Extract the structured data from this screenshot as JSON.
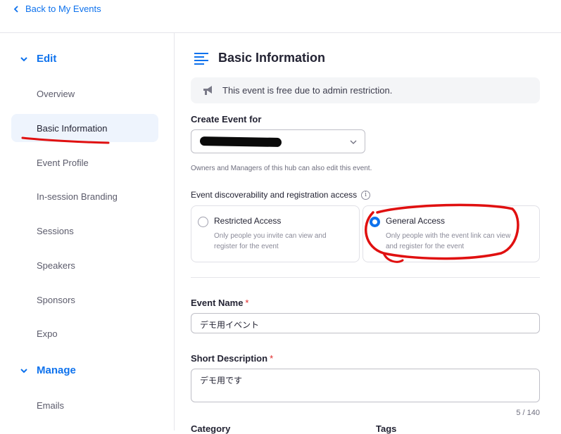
{
  "header": {
    "back_label": "Back to My Events"
  },
  "sidebar": {
    "edit_section": "Edit",
    "manage_section": "Manage",
    "items": [
      {
        "label": "Overview"
      },
      {
        "label": "Basic Information",
        "active": true
      },
      {
        "label": "Event Profile"
      },
      {
        "label": "In-session Branding"
      },
      {
        "label": "Sessions"
      },
      {
        "label": "Speakers"
      },
      {
        "label": "Sponsors"
      },
      {
        "label": "Expo"
      }
    ],
    "manage_items": [
      {
        "label": "Emails"
      }
    ]
  },
  "main": {
    "title": "Basic Information",
    "notice": "This event is free due to admin restriction.",
    "create_for_label": "Create Event for",
    "create_for_helper": "Owners and Managers of this hub can also edit this event.",
    "access_label": "Event discoverability and registration access",
    "access_info_glyph": "i",
    "access_options": [
      {
        "title": "Restricted Access",
        "desc": "Only people you invite can view and register for the event",
        "selected": false
      },
      {
        "title": "General Access",
        "desc": "Only people with the event link can view and register for the event",
        "selected": true
      }
    ],
    "event_name_label": "Event Name",
    "event_name_value": "デモ用イベント",
    "short_desc_label": "Short Description",
    "short_desc_value": "デモ用です",
    "short_desc_counter": "5 / 140",
    "required_mark": "*",
    "category_label": "Category",
    "tags_label": "Tags"
  },
  "colors": {
    "accent": "#0e72ed",
    "annotation": "#e01010",
    "active_bg": "#eef4fd"
  }
}
